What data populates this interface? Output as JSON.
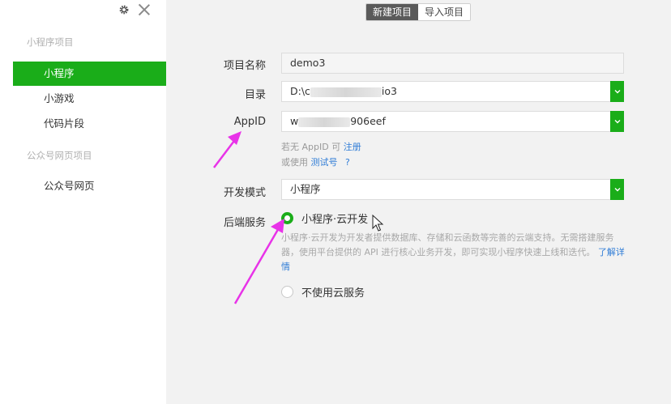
{
  "sidebar": {
    "section_miniprogram": "小程序项目",
    "item_miniprogram": "小程序",
    "item_minigame": "小游戏",
    "item_snippet": "代码片段",
    "section_official": "公众号网页项目",
    "item_official_web": "公众号网页"
  },
  "tabs": {
    "new_project": "新建项目",
    "import_project": "导入项目"
  },
  "form": {
    "project_name_label": "项目名称",
    "project_name_value": "demo3",
    "directory_label": "目录",
    "directory_prefix": "D:\\c",
    "directory_suffix": "io3",
    "appid_label": "AppID",
    "appid_prefix": "w",
    "appid_suffix": "906eef",
    "appid_hint_1": "若无 AppID 可",
    "register_link": "注册",
    "appid_hint_2": "或使用",
    "test_account_link": "测试号",
    "help_mark": "?",
    "dev_mode_label": "开发模式",
    "dev_mode_value": "小程序",
    "backend_label": "后端服务",
    "cloud_option": "小程序·云开发",
    "cloud_desc": "小程序·云开发为开发者提供数据库、存储和云函数等完善的云端支持。无需搭建服务器，使用平台提供的 API 进行核心业务开发，即可实现小程序快速上线和迭代。",
    "learn_more_link": "了解详情",
    "no_cloud_option": "不使用云服务"
  },
  "colors": {
    "accent": "#1aad19",
    "annotation": "#e833e8",
    "link": "#2f7cd6"
  }
}
